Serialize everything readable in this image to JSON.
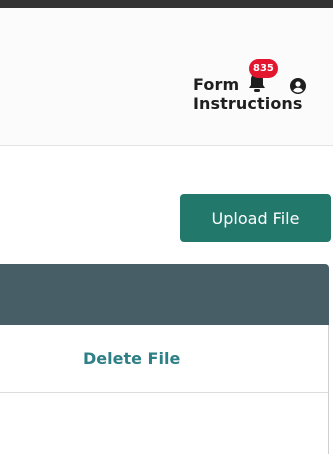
{
  "header": {
    "form_instructions_label": "Form Instructions",
    "notification_count": "835",
    "bell_icon": "bell-icon",
    "user_icon": "user-circle-icon"
  },
  "toolbar": {
    "upload_label": "Upload File"
  },
  "table": {
    "rows": [
      {
        "action_label": "Delete File"
      }
    ]
  },
  "colors": {
    "accent": "#22786b",
    "table_header": "#475e66",
    "link": "#2e7f86",
    "badge": "#e4152f"
  }
}
